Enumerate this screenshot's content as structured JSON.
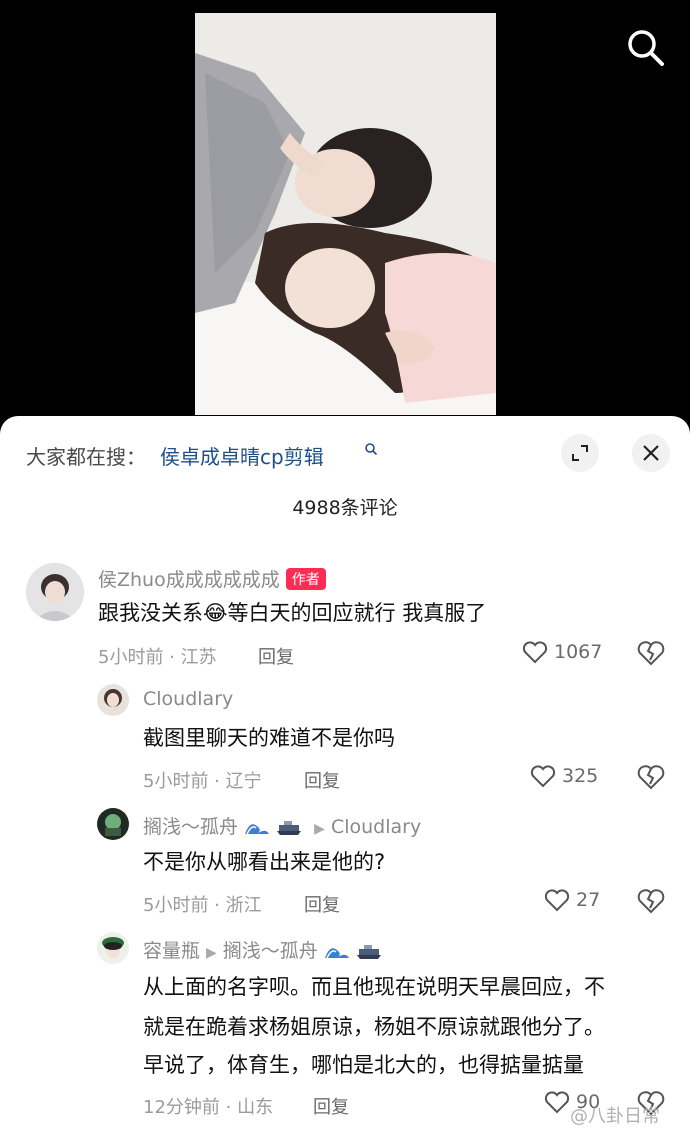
{
  "header": {
    "trend_prefix": "大家都在搜：",
    "trend_query": "侯卓成卓晴cp剪辑",
    "comment_count": "4988条评论"
  },
  "comments": [
    {
      "user": "侯Zhuo成成成成成成",
      "badge": "作者",
      "text": "跟我没关系😂等白天的回应就行 我真服了",
      "time_location": "5小时前 · 江苏",
      "reply_label": "回复",
      "likes": "1067"
    },
    {
      "user": "Cloudlary",
      "text": "截图里聊天的难道不是你吗",
      "time_location": "5小时前 · 辽宁",
      "reply_label": "回复",
      "likes": "325"
    },
    {
      "user": "搁浅～孤舟",
      "reply_to": "Cloudlary",
      "text": "不是你从哪看出来是他的?",
      "time_location": "5小时前 · 浙江",
      "reply_label": "回复",
      "likes": "27"
    },
    {
      "user": "容量瓶",
      "reply_to": "搁浅～孤舟",
      "text_lines": [
        "从上面的名字呗。而且他现在说明天早晨回应，不",
        "就是在跪着求杨姐原谅，杨姐不原谅就跟他分了。",
        "早说了，体育生，哪怕是北大的，也得掂量掂量"
      ],
      "time_location": "12分钟前 · 山东",
      "reply_label": "回复",
      "likes": "90"
    }
  ],
  "watermark": "@八卦日常",
  "icons": {
    "search": "search-icon",
    "expand": "expand-icon",
    "close": "close-icon",
    "like": "heart-icon",
    "dislike": "broken-heart-icon"
  },
  "colors": {
    "badge": "#fe2c55",
    "link": "#1f4f8a",
    "background_top": "#000000"
  }
}
